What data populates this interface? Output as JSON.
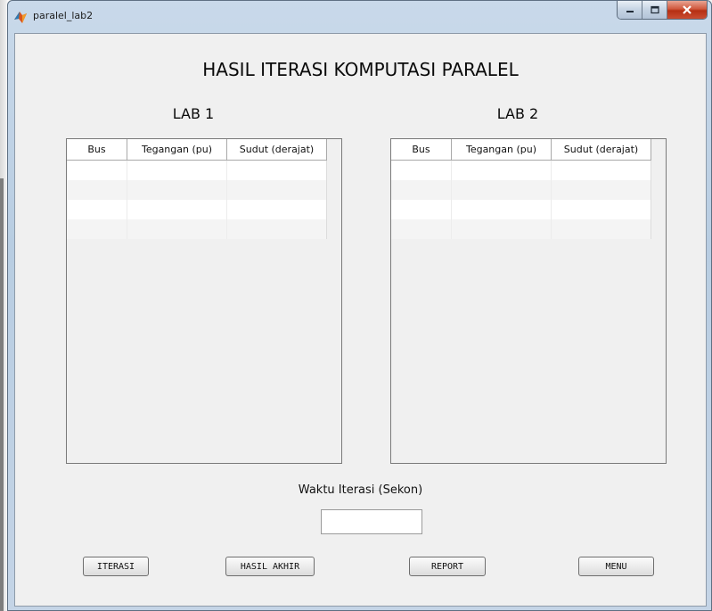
{
  "window": {
    "title": "paralel_lab2"
  },
  "heading": "HASIL ITERASI KOMPUTASI PARALEL",
  "lab1": {
    "label": "LAB 1",
    "columns": [
      "Bus",
      "Tegangan (pu)",
      "Sudut (derajat)"
    ]
  },
  "lab2": {
    "label": "LAB 2",
    "columns": [
      "Bus",
      "Tegangan (pu)",
      "Sudut (derajat)"
    ]
  },
  "waktu": {
    "label": "Waktu Iterasi (Sekon)",
    "value": ""
  },
  "buttons": {
    "iterasi": "ITERASI",
    "hasil_akhir": "HASIL AKHIR",
    "report": "REPORT",
    "menu": "MENU"
  },
  "icons": {
    "app": "matlab-icon",
    "minimize": "minimize-icon",
    "maximize": "maximize-icon",
    "close": "close-icon"
  },
  "colors": {
    "close_button": "#c94d32",
    "client_bg": "#f0f0f0"
  }
}
